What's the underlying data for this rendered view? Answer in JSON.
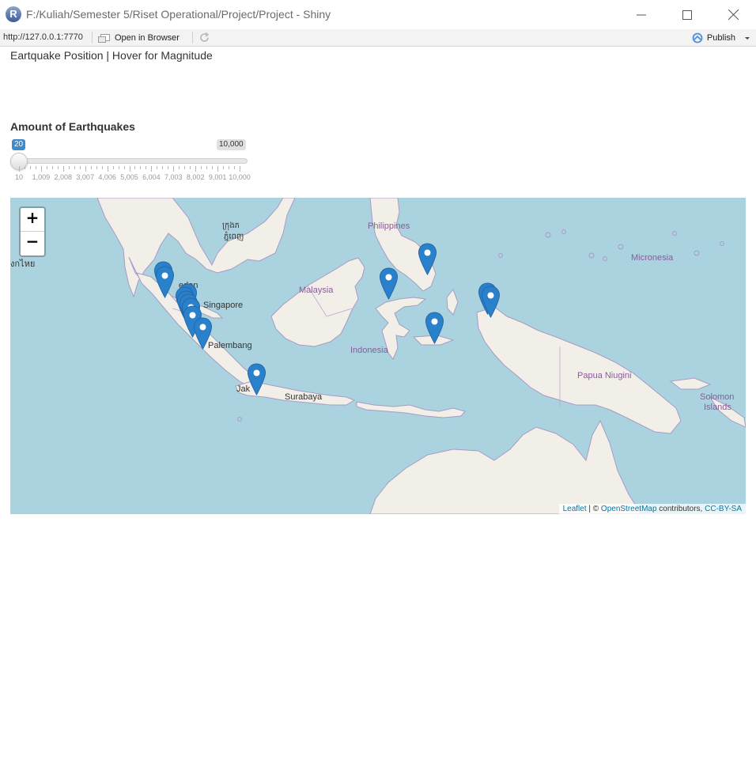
{
  "window": {
    "icon_letter": "R",
    "title": "F:/Kuliah/Semester 5/Riset Operational/Project/Project - Shiny"
  },
  "toolbar": {
    "url": "http://127.0.0.1:7770",
    "open_in_browser": "Open in Browser",
    "publish": "Publish"
  },
  "page": {
    "title": "Eartquake Position | Hover for Magnitude"
  },
  "slider": {
    "label": "Amount of Earthquakes",
    "value": 20,
    "value_label": "20",
    "min": 10,
    "max": 10000,
    "max_label": "10,000",
    "tick_labels": [
      "10",
      "1,009",
      "2,008",
      "3,007",
      "4,006",
      "5,005",
      "6,004",
      "7,003",
      "8,002",
      "9,001",
      "10,000"
    ]
  },
  "map": {
    "zoom_in": "+",
    "zoom_out": "−",
    "labels": {
      "philippines": "Philippines",
      "micronesia": "Micronesia",
      "malaysia": "Malaysia",
      "indonesia": "Indonesia",
      "papua": "Papua Niugini",
      "solomon": "Solomon",
      "islands": "Islands",
      "medan": "edan",
      "singapore": "Singapore",
      "palembang": "Palembang",
      "jakarta": "Jak",
      "surabaya": "Surabaya",
      "thai_label": "งกไหย",
      "khmer_1": "ក្រុងភ",
      "khmer_2": "ភ្នំពេញ"
    },
    "attribution": {
      "leaflet": "Leaflet",
      "sep": " | © ",
      "osm": "OpenStreetMap",
      "contrib": " contributors, ",
      "license": "CC-BY-SA"
    },
    "colors": {
      "water": "#aad3df",
      "land": "#f2efe9",
      "marker": "#2a81cb"
    }
  }
}
